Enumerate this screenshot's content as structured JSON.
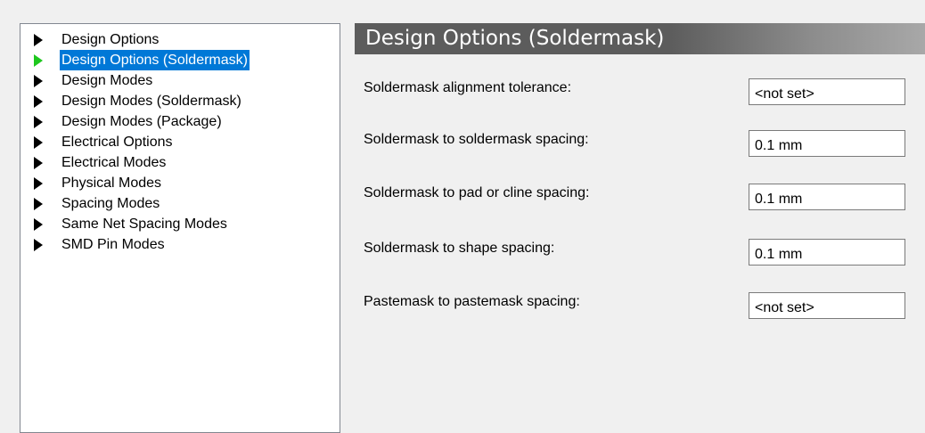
{
  "tree": {
    "items": [
      {
        "label": "Design Options",
        "selected": false
      },
      {
        "label": "Design Options (Soldermask)",
        "selected": true
      },
      {
        "label": "Design Modes",
        "selected": false
      },
      {
        "label": "Design Modes (Soldermask)",
        "selected": false
      },
      {
        "label": "Design Modes (Package)",
        "selected": false
      },
      {
        "label": "Electrical Options",
        "selected": false
      },
      {
        "label": "Electrical Modes",
        "selected": false
      },
      {
        "label": "Physical Modes",
        "selected": false
      },
      {
        "label": "Spacing Modes",
        "selected": false
      },
      {
        "label": "Same Net Spacing Modes",
        "selected": false
      },
      {
        "label": "SMD Pin Modes",
        "selected": false
      }
    ]
  },
  "content": {
    "title": "Design Options (Soldermask)",
    "fields": [
      {
        "label": "Soldermask alignment tolerance:",
        "value": "<not set>"
      },
      {
        "label": "Soldermask to soldermask spacing:",
        "value": "0.1 mm"
      },
      {
        "label": "Soldermask to pad or cline spacing:",
        "value": "0.1 mm"
      },
      {
        "label": "Soldermask to shape spacing:",
        "value": "0.1 mm"
      },
      {
        "label": "Pastemask to pastemask spacing:",
        "value": "<not set>"
      }
    ]
  },
  "colors": {
    "selection": "#0078d7",
    "selected_arrow": "#1ec71e",
    "header_dark": "#5c5c5c",
    "header_light": "#a8a8a8"
  },
  "icons": {
    "tree_item": "triangle-right-icon"
  }
}
